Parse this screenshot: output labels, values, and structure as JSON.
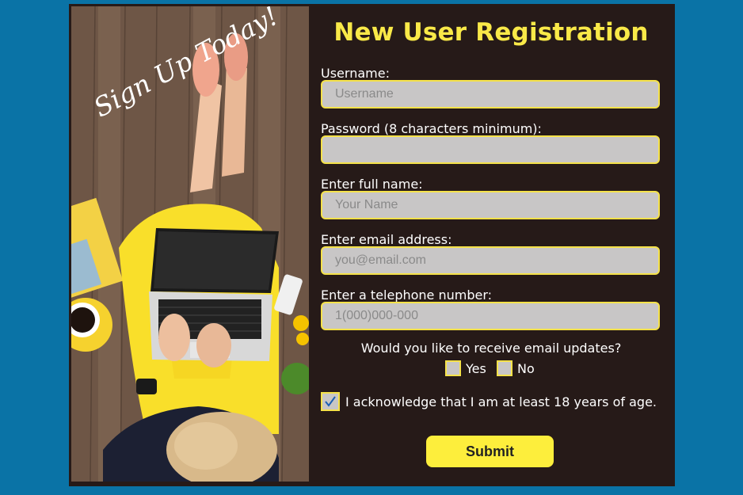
{
  "photo": {
    "overlay_text": "Sign Up Today!"
  },
  "form": {
    "title": "New User Registration",
    "fields": [
      {
        "label": "Username:",
        "placeholder": "Username",
        "type": "text"
      },
      {
        "label": "Password (8 characters minimum):",
        "placeholder": "",
        "type": "password"
      },
      {
        "label": "Enter full name:",
        "placeholder": "Your Name",
        "type": "text"
      },
      {
        "label": "Enter email address:",
        "placeholder": "you@email.com",
        "type": "email"
      },
      {
        "label": "Enter a telephone number:",
        "placeholder": "1(000)000-000",
        "type": "tel"
      }
    ],
    "updates_question": "Would you like to receive email updates?",
    "updates_options": [
      {
        "label": "Yes",
        "checked": false
      },
      {
        "label": "No",
        "checked": false
      }
    ],
    "acknowledge": {
      "label": "I acknowledge that I am at least 18 years of age.",
      "checked": true
    },
    "submit_label": "Submit"
  },
  "colors": {
    "page_background": "#0a73a6",
    "card_background": "#261a18",
    "accent_yellow": "#f9e948",
    "input_background": "#c8c6c6"
  }
}
